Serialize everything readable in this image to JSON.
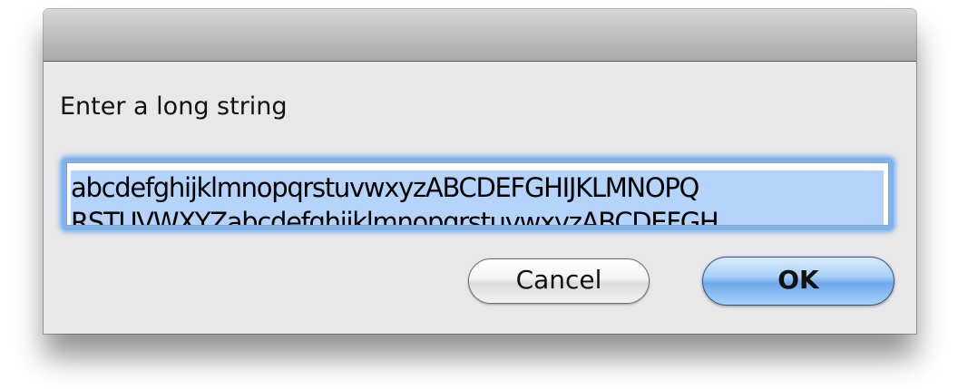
{
  "dialog": {
    "prompt": "Enter a long string",
    "input": {
      "line1": "abcdefghijklmnopqrstuvwxyzABCDEFGHIJKLMNOPQ",
      "line2": "RSTUVWXYZabcdefghijklmnopqrstuvwxyzABCDEFGH"
    },
    "buttons": {
      "cancel_label": "Cancel",
      "ok_label": "OK"
    }
  },
  "colors": {
    "dialog_background": "#e8e8e8",
    "selection_highlight": "#b4d4fc",
    "focus_ring": "#7fb2ea",
    "default_button": "#6fa8ea"
  }
}
